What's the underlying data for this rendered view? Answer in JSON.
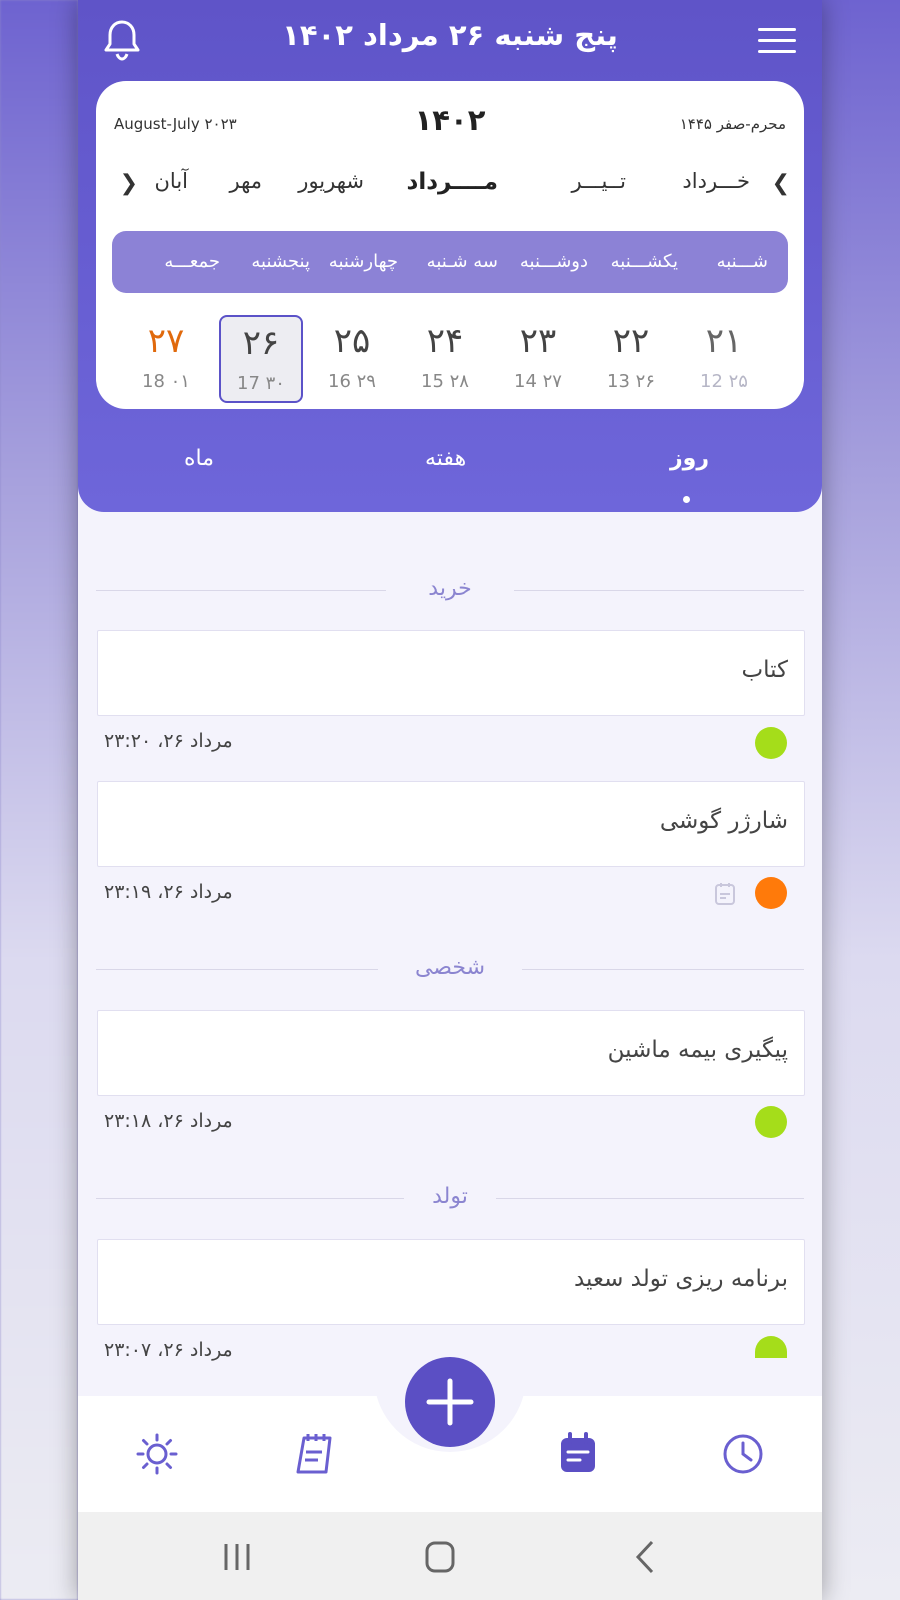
{
  "header": {
    "title": "پنج شنبه ۲۶ مرداد ۱۴۰۲"
  },
  "calendar": {
    "gregorian_range": "August-July ۲۰۲۳",
    "year": "۱۴۰۲",
    "hijri_range": "محرم-صفر ۱۴۴۵",
    "months": [
      "خـــرداد",
      "تــیـــر",
      "مــــرداد",
      "شهریور",
      "مهر",
      "آبان"
    ],
    "active_month": "مــــرداد",
    "weekdays": [
      "شـــنبه",
      "یکشـــنبه",
      "دوشـــنبه",
      "سه شـنبه",
      "چهارشنبه",
      "پنجشنبه",
      "جمعـــه"
    ],
    "days": [
      {
        "persian": "۲۱",
        "sub": "12 ۲۵"
      },
      {
        "persian": "۲۲",
        "sub": "13 ۲۶"
      },
      {
        "persian": "۲۳",
        "sub": "14 ۲۷"
      },
      {
        "persian": "۲۴",
        "sub": "15 ۲۸"
      },
      {
        "persian": "۲۵",
        "sub": "16 ۲۹"
      },
      {
        "persian": "۲۶",
        "sub": "17 ۳۰"
      },
      {
        "persian": "۲۷",
        "sub": "18 ۰۱"
      }
    ]
  },
  "view_tabs": {
    "day": "روز",
    "week": "هفته",
    "month": "ماه",
    "active": "day"
  },
  "sections": [
    {
      "label": "خرید",
      "tasks": [
        {
          "title": "کتاب",
          "meta": "مرداد ۲۶، ۲۳:۲۰",
          "color": "#a5dd1a",
          "has_note": false
        },
        {
          "title": "شارژر گوشی",
          "meta": "مرداد ۲۶، ۲۳:۱۹",
          "color": "#ff7a0a",
          "has_note": true
        }
      ]
    },
    {
      "label": "شخصی",
      "tasks": [
        {
          "title": "پیگیری بیمه ماشین",
          "meta": "مرداد ۲۶، ۲۳:۱۸",
          "color": "#a5dd1a",
          "has_note": false
        }
      ]
    },
    {
      "label": "تولد",
      "tasks": [
        {
          "title": "برنامه ریزی تولد سعید",
          "meta": "مرداد ۲۶، ۲۳:۰۷",
          "color": "#a5dd1a",
          "has_note": false
        }
      ]
    }
  ],
  "colors": {
    "accent": "#5b4fc4",
    "header": "#6e66da",
    "friday": "#e0690c",
    "green": "#a5dd1a",
    "orange": "#ff7a0a"
  },
  "bottom_nav": [
    "sun-icon",
    "notes-icon",
    "add-icon",
    "tasks-icon",
    "clock-icon"
  ],
  "system_nav": [
    "recents-icon",
    "home-icon",
    "back-icon"
  ]
}
